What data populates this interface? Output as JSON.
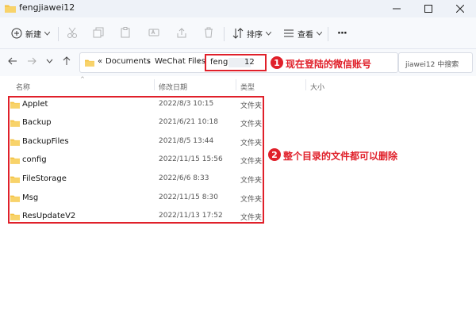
{
  "window": {
    "title": "fengjiawei12"
  },
  "toolbar": {
    "new_label": "新建",
    "sort_label": "排序",
    "view_label": "查看",
    "more_label": "···"
  },
  "nav": {
    "address": {
      "overflow": "«",
      "crumbs": [
        "Documents",
        "WeChat Files"
      ],
      "current_prefix": "feng",
      "current_suffix": "12"
    },
    "search_placeholder": "jiawei12 中搜索"
  },
  "columns": {
    "name": "名称",
    "modified": "修改日期",
    "type": "类型",
    "size": "大小"
  },
  "files": [
    {
      "name": "Applet",
      "modified": "2022/8/3 10:15",
      "type": "文件夹"
    },
    {
      "name": "Backup",
      "modified": "2021/6/21 10:18",
      "type": "文件夹"
    },
    {
      "name": "BackupFiles",
      "modified": "2021/8/5 13:44",
      "type": "文件夹"
    },
    {
      "name": "config",
      "modified": "2022/11/15 15:56",
      "type": "文件夹"
    },
    {
      "name": "FileStorage",
      "modified": "2022/6/6 8:33",
      "type": "文件夹"
    },
    {
      "name": "Msg",
      "modified": "2022/11/15 8:30",
      "type": "文件夹"
    },
    {
      "name": "ResUpdateV2",
      "modified": "2022/11/13 17:52",
      "type": "文件夹"
    }
  ],
  "annotations": {
    "a1": {
      "num": "1",
      "text": "现在登陆的微信账号"
    },
    "a2": {
      "num": "2",
      "text": "整个目录的文件都可以删除"
    }
  },
  "colors": {
    "accent_red": "#e0202a",
    "folder": "#f4c142"
  }
}
